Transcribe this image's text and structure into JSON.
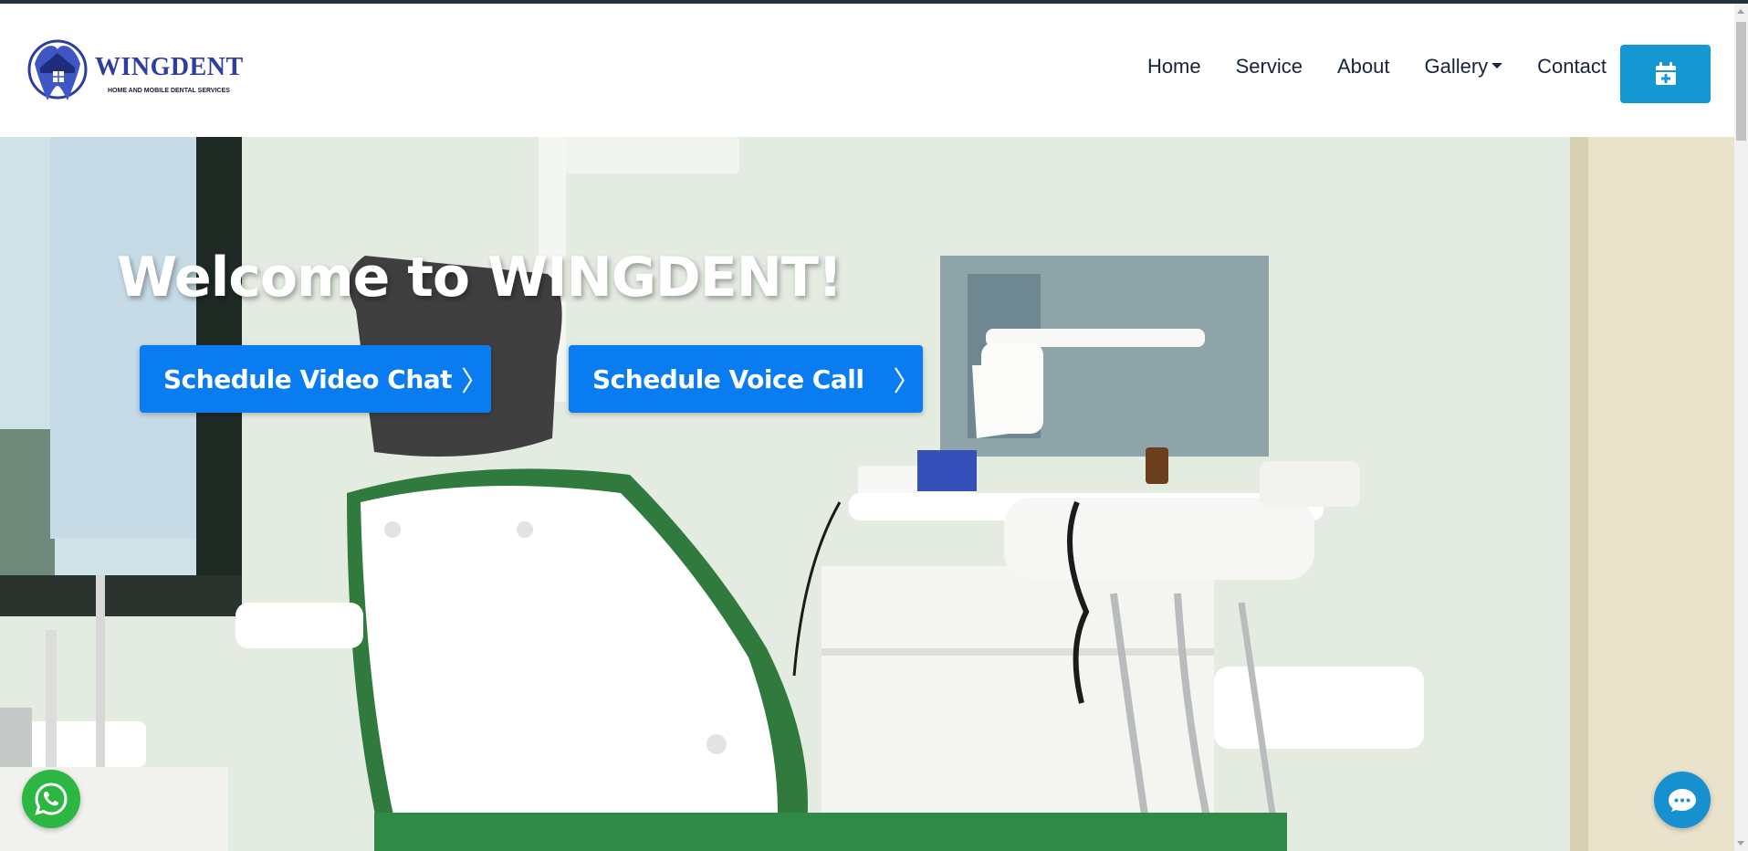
{
  "brand": {
    "name": "WINGDENT",
    "tagline": "HOME AND MOBILE DENTAL SERVICES",
    "primary_color": "#2f3e9e"
  },
  "nav": {
    "items": [
      {
        "label": "Home"
      },
      {
        "label": "Service"
      },
      {
        "label": "About"
      },
      {
        "label": "Gallery"
      },
      {
        "label": "Contact"
      }
    ],
    "appointment_icon": "calendar-plus-icon",
    "appointment_color": "#1598d2"
  },
  "hero": {
    "title": "Welcome to WINGDENT!",
    "buttons": [
      {
        "label": "Schedule Video Chat",
        "icon": "chevron-right-icon"
      },
      {
        "label": "Schedule Voice Call",
        "icon": "chevron-right-icon"
      }
    ],
    "button_color": "#0a7cf2",
    "background_image": "dental-clinic-chair"
  },
  "floating": {
    "whatsapp_icon": "whatsapp-icon",
    "whatsapp_color": "#2bb741",
    "chat_icon": "chat-bubble-icon",
    "chat_color": "#1790cf"
  },
  "chevron_glyph": "〉"
}
